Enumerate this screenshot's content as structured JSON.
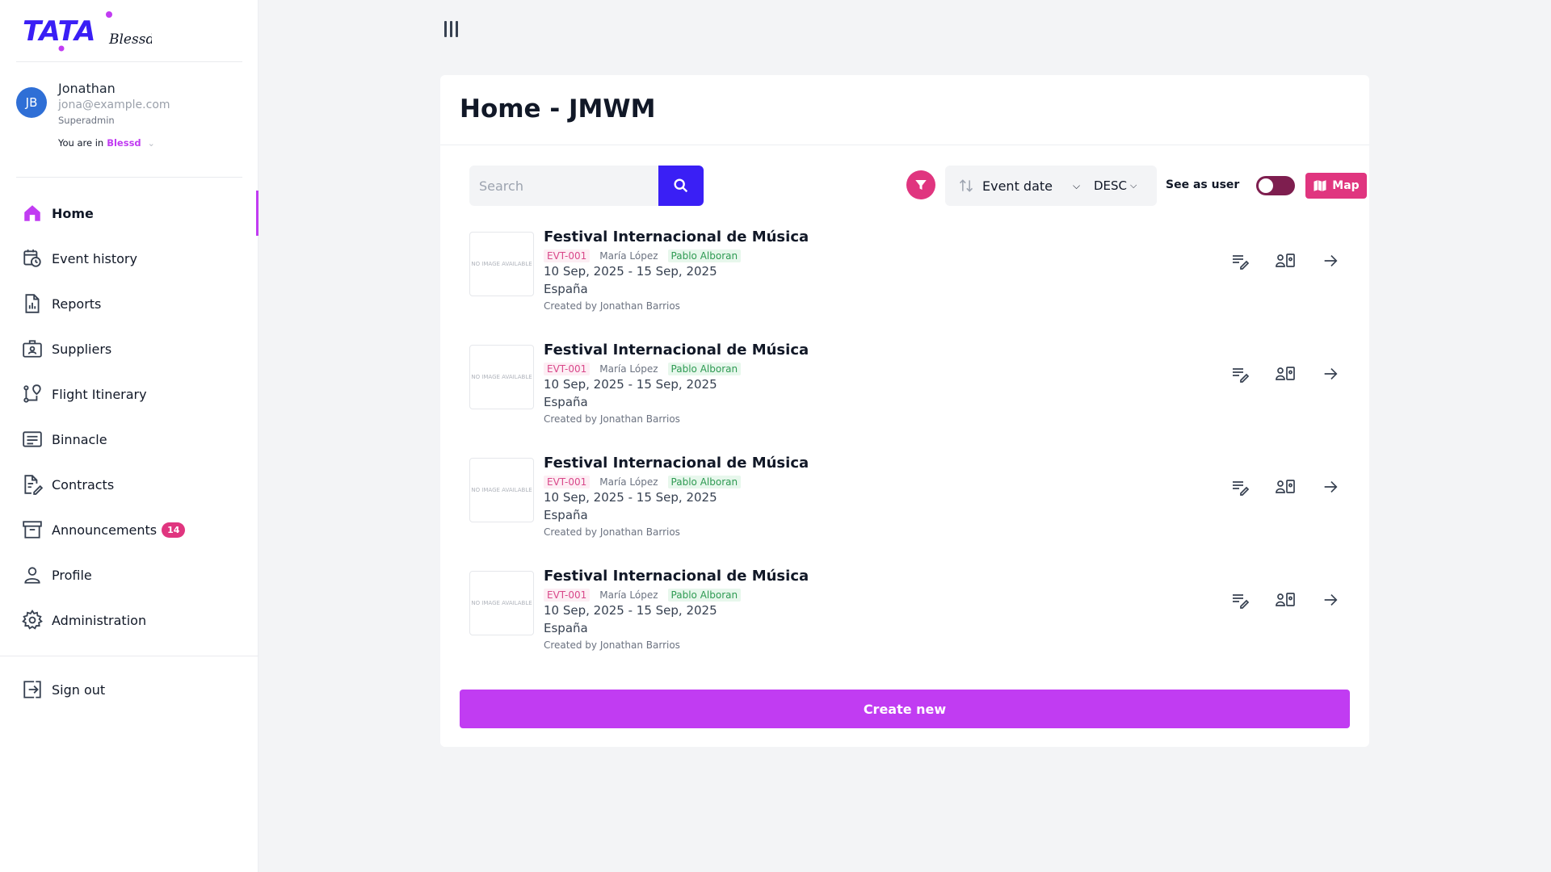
{
  "brand": {
    "logo_text": "TATA",
    "logo_sub": "Blessd",
    "accent": "#c13cf2",
    "pink": "#e0357f",
    "blue": "#3a1ff5"
  },
  "user": {
    "initials": "JB",
    "name": "Jonathan",
    "email": "jona@example.com",
    "role": "Superadmin",
    "workspace_prefix": "You are in",
    "workspace": "Blessd"
  },
  "sidebar": {
    "items": [
      {
        "label": "Home",
        "icon": "home-icon",
        "active": true
      },
      {
        "label": "Event history",
        "icon": "calendar-clock-icon"
      },
      {
        "label": "Reports",
        "icon": "report-icon"
      },
      {
        "label": "Suppliers",
        "icon": "briefcase-icon"
      },
      {
        "label": "Flight Itinerary",
        "icon": "route-icon"
      },
      {
        "label": "Binnacle",
        "icon": "log-icon"
      },
      {
        "label": "Contracts",
        "icon": "contract-icon"
      },
      {
        "label": "Announcements",
        "icon": "archive-icon",
        "badge": "14"
      },
      {
        "label": "Profile",
        "icon": "person-icon"
      },
      {
        "label": "Administration",
        "icon": "gear-icon"
      }
    ],
    "sign_out": "Sign out"
  },
  "main": {
    "title": "Home - JMWM",
    "search": {
      "placeholder": "Search",
      "value": ""
    },
    "sort": {
      "field": "Event date",
      "direction": "DESC"
    },
    "see_as_user_label": "See as user",
    "see_as_user_on": false,
    "map_label": "Map",
    "create_label": "Create new",
    "events": [
      {
        "thumb": "NO IMAGE AVAILABLE",
        "title": "Festival Internacional de Música",
        "code": "EVT-001",
        "person": "María López",
        "artist": "Pablo Alboran",
        "dates": "10 Sep, 2025 - 15 Sep, 2025",
        "country": "España",
        "creator": "Created by Jonathan Barrios"
      },
      {
        "thumb": "NO IMAGE AVAILABLE",
        "title": "Festival Internacional de Música",
        "code": "EVT-001",
        "person": "María López",
        "artist": "Pablo Alboran",
        "dates": "10 Sep, 2025 - 15 Sep, 2025",
        "country": "España",
        "creator": "Created by Jonathan Barrios"
      },
      {
        "thumb": "NO IMAGE AVAILABLE",
        "title": "Festival Internacional de Música",
        "code": "EVT-001",
        "person": "María López",
        "artist": "Pablo Alboran",
        "dates": "10 Sep, 2025 - 15 Sep, 2025",
        "country": "España",
        "creator": "Created by Jonathan Barrios"
      },
      {
        "thumb": "NO IMAGE AVAILABLE",
        "title": "Festival Internacional de Música",
        "code": "EVT-001",
        "person": "María López",
        "artist": "Pablo Alboran",
        "dates": "10 Sep, 2025 - 15 Sep, 2025",
        "country": "España",
        "creator": "Created by Jonathan Barrios"
      }
    ]
  }
}
